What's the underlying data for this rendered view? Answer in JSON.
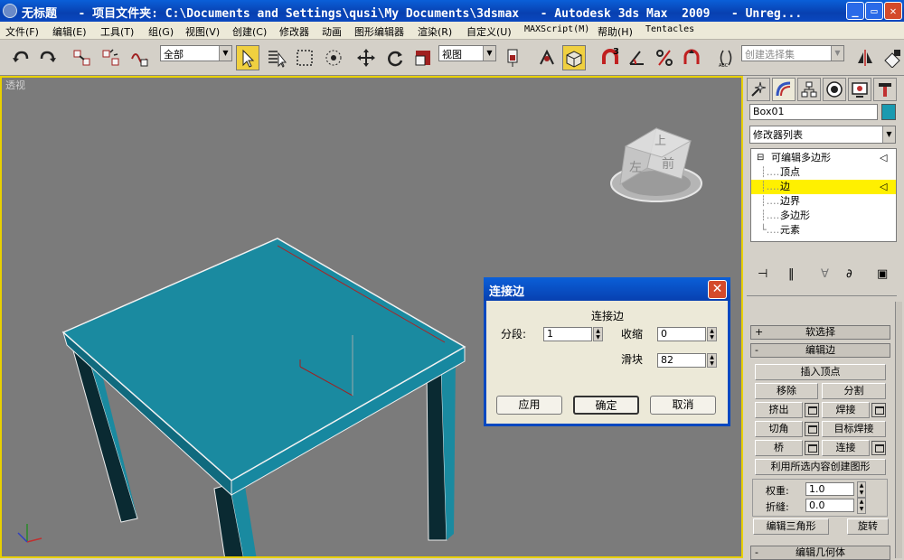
{
  "window": {
    "title": "无标题   - 项目文件夹: C:\\Documents and Settings\\qusi\\My Documents\\3dsmax   - Autodesk 3ds Max  2009   - Unreg..."
  },
  "menu": [
    "文件(F)",
    "编辑(E)",
    "工具(T)",
    "组(G)",
    "视图(V)",
    "创建(C)",
    "修改器",
    "动画",
    "图形编辑器",
    "渲染(R)",
    "自定义(U)",
    "MAXScript(M)",
    "帮助(H)",
    "Tentacles"
  ],
  "toolbar": {
    "filter_value": "全部",
    "refcoord_value": "视图",
    "named_selection_placeholder": "创建选择集",
    "angle_snap_num": "3"
  },
  "viewport": {
    "label": "透视",
    "viewcube": {
      "top": "上",
      "front": "前",
      "left": "左"
    },
    "colors": {
      "object": "#1a8aa0",
      "background": "#7b7b7b",
      "border": "#e8d000"
    }
  },
  "dialog": {
    "title": "连接边",
    "group_label": "连接边",
    "segments_label": "分段:",
    "segments_value": "1",
    "pinch_label": "收缩",
    "pinch_value": "0",
    "slide_label": "滑块",
    "slide_value": "82",
    "apply": "应用",
    "ok": "确定",
    "cancel": "取消"
  },
  "command_panel": {
    "object_name": "Box01",
    "object_color": "#1a9ab0",
    "modifier_list": "修改器列表",
    "stack": {
      "base": "可编辑多边形",
      "items": [
        "顶点",
        "边",
        "边界",
        "多边形",
        "元素"
      ],
      "selected_index": 1
    },
    "rollouts": {
      "soft_select": "软选择",
      "edit_edges": "编辑边",
      "edit_geometry": "编辑几何体"
    },
    "buttons": {
      "insert_vertex": "插入顶点",
      "remove": "移除",
      "split": "分割",
      "extrude": "挤出",
      "weld": "焊接",
      "chamfer": "切角",
      "target_weld": "目标焊接",
      "bridge": "桥",
      "connect": "连接",
      "create_shape": "利用所选内容创建图形",
      "edit_tri": "编辑三角形",
      "turn": "旋转"
    },
    "weight_label": "权重:",
    "weight_value": "1.0",
    "crease_label": "折缝:",
    "crease_value": "0.0"
  }
}
